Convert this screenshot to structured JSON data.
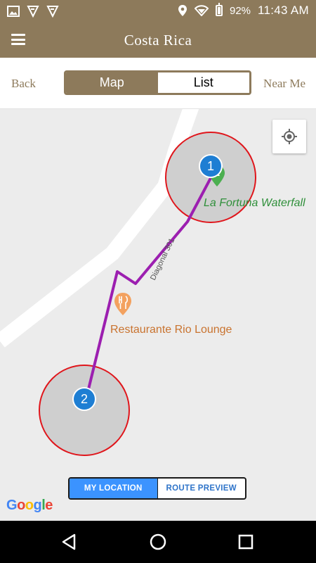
{
  "status_bar": {
    "battery": "92%",
    "time": "11:43 AM",
    "left_icons": [
      "image-notification-icon",
      "notification-icon",
      "notification-icon"
    ],
    "right_icons": [
      "location-icon",
      "wifi-icon",
      "battery-icon"
    ]
  },
  "app_bar": {
    "title": "Costa Rica",
    "menu_icon": "hamburger-menu-icon"
  },
  "sub_bar": {
    "back_label": "Back",
    "near_me_label": "Near Me",
    "tabs": [
      {
        "label": "Map",
        "active": true
      },
      {
        "label": "List",
        "active": false
      }
    ]
  },
  "map": {
    "road_label": "Diagonal 301",
    "places": [
      {
        "name": "La Fortuna Waterfall",
        "icon": "green-place-pin-icon"
      },
      {
        "name": "Restaurante Rio Lounge",
        "icon": "restaurant-pin-icon"
      }
    ],
    "markers": [
      {
        "number": "1"
      },
      {
        "number": "2"
      }
    ],
    "locate_button_icon": "my-location-crosshair-icon",
    "attribution": "Google",
    "colors": {
      "route": "#9c1fb0",
      "geofence_border": "#e0151b",
      "geofence_fill": "#cfcfcf",
      "marker": "#1e7ed3"
    }
  },
  "view_toggle": {
    "options": [
      {
        "label": "MY LOCATION",
        "active": true
      },
      {
        "label": "ROUTE PREVIEW",
        "active": false
      }
    ]
  },
  "nav_bar": {
    "icons": [
      "back-triangle-icon",
      "home-circle-icon",
      "recents-square-icon"
    ]
  },
  "theme": {
    "brand": "#8d7a5b",
    "accent_blue": "#3b93ff"
  }
}
